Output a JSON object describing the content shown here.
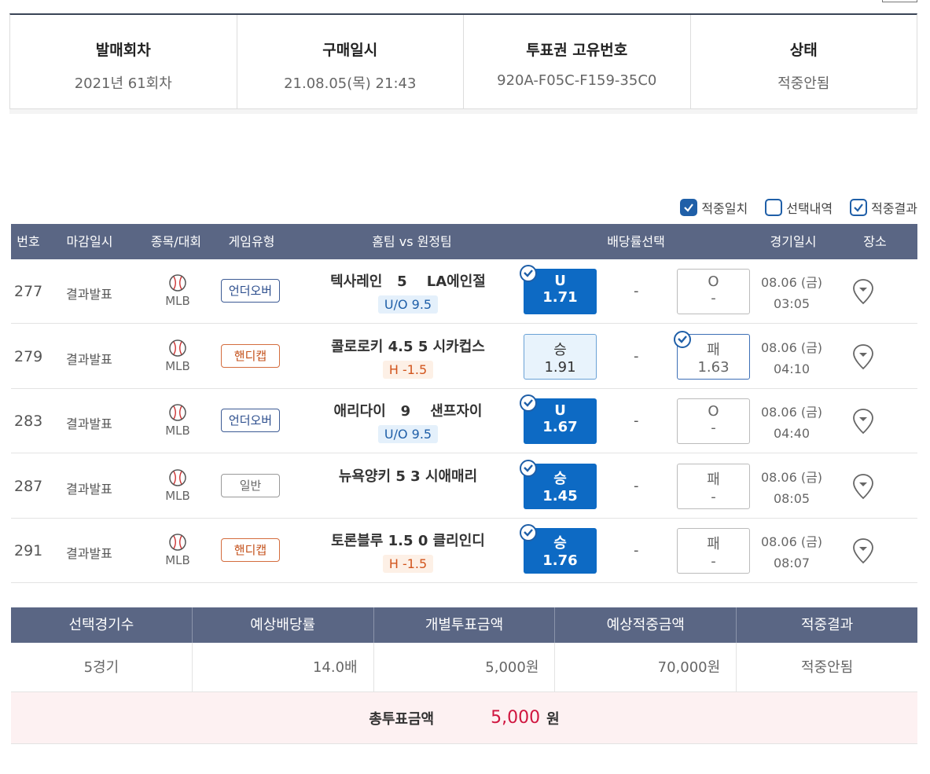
{
  "summary": {
    "round_label": "발매회차",
    "round_value": "2021년 61회차",
    "purchase_label": "구매일시",
    "purchase_value": "21.08.05(목) 21:43",
    "ticket_label": "투표권 고유번호",
    "ticket_value": "920A-F05C-F159-35C0",
    "status_label": "상태",
    "status_value": "적중안됨"
  },
  "legend": {
    "match": "적중일치",
    "selection": "선택내역",
    "result": "적중결과"
  },
  "table_headers": {
    "num": "번호",
    "deadline": "마감일시",
    "sport": "종목/대회",
    "type": "게임유형",
    "teams": "홈팀 vs 원정팀",
    "odds": "배당률선택",
    "date": "경기일시",
    "venue": "장소"
  },
  "rows": [
    {
      "num": "277",
      "deadline": "결과발표",
      "sport": "MLB",
      "type": "언더오버",
      "home": "텍사레인",
      "score": "5",
      "away": "LA에인절",
      "sub": "U/O 9.5",
      "left_l1": "U",
      "left_l2": "1.71",
      "mid": "-",
      "right_l1": "O",
      "right_l2": "-",
      "date": "08.06 (금)",
      "time": "03:05"
    },
    {
      "num": "279",
      "deadline": "결과발표",
      "sport": "MLB",
      "type": "핸디캡",
      "home": "콜로로키 4.5",
      "score": "5",
      "away": "시카컵스",
      "sub": "H -1.5",
      "left_l1": "승",
      "left_l2": "1.91",
      "mid": "-",
      "right_l1": "패",
      "right_l2": "1.63",
      "date": "08.06 (금)",
      "time": "04:10"
    },
    {
      "num": "283",
      "deadline": "결과발표",
      "sport": "MLB",
      "type": "언더오버",
      "home": "애리다이",
      "score": "9",
      "away": "샌프자이",
      "sub": "U/O 9.5",
      "left_l1": "U",
      "left_l2": "1.67",
      "mid": "-",
      "right_l1": "O",
      "right_l2": "-",
      "date": "08.06 (금)",
      "time": "04:40"
    },
    {
      "num": "287",
      "deadline": "결과발표",
      "sport": "MLB",
      "type": "일반",
      "home": "뉴욕양키 5",
      "score": "3",
      "away": "시애매리",
      "sub": "",
      "left_l1": "승",
      "left_l2": "1.45",
      "mid": "-",
      "right_l1": "패",
      "right_l2": "-",
      "date": "08.06 (금)",
      "time": "08:05"
    },
    {
      "num": "291",
      "deadline": "결과발표",
      "sport": "MLB",
      "type": "핸디캡",
      "home": "토론블루 1.5",
      "score": "0",
      "away": "클리인디",
      "sub": "H -1.5",
      "left_l1": "승",
      "left_l2": "1.76",
      "mid": "-",
      "right_l1": "패",
      "right_l2": "-",
      "date": "08.06 (금)",
      "time": "08:07"
    }
  ],
  "bottom": {
    "h1": "선택경기수",
    "h2": "예상배당률",
    "h3": "개별투표금액",
    "h4": "예상적중금액",
    "h5": "적중결과",
    "v1": "5경기",
    "v2": "14.0배",
    "v3": "5,000원",
    "v4": "70,000원",
    "v5": "적중안됨",
    "total_label": "총투표금액",
    "total_value": "5,000",
    "total_unit": "원"
  },
  "colors": {
    "header": "#5a6684",
    "selected": "#0d6ac4",
    "accent_red": "#d0153f"
  }
}
